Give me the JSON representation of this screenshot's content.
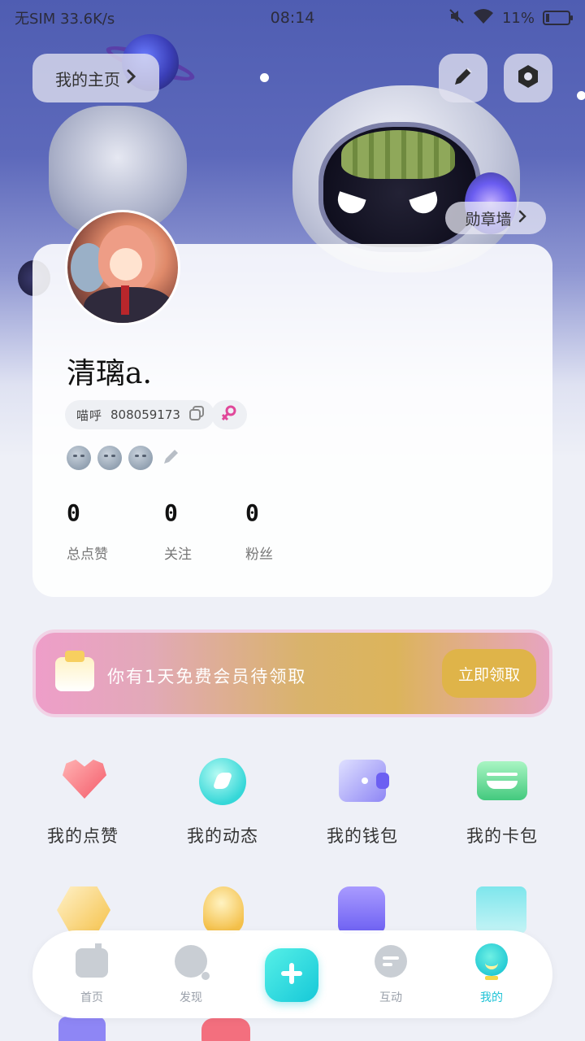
{
  "status_bar": {
    "left": "无SIM 33.6K/s",
    "time": "08:14",
    "battery": "11%"
  },
  "header": {
    "home_button_label": "我的主页",
    "badge_wall_label": "勋章墙"
  },
  "profile": {
    "nickname": "清璃a.",
    "id_label": "喵呼",
    "id_value": "808059173",
    "stats": [
      {
        "value": "0",
        "label": "总点赞"
      },
      {
        "value": "0",
        "label": "关注"
      },
      {
        "value": "0",
        "label": "粉丝"
      }
    ]
  },
  "vip_banner": {
    "text": "你有1天免费会员待领取",
    "claim_label": "立即领取"
  },
  "features": [
    {
      "label": "我的点赞",
      "icon": "heart-icon"
    },
    {
      "label": "我的动态",
      "icon": "moment-icon"
    },
    {
      "label": "我的钱包",
      "icon": "wallet-icon"
    },
    {
      "label": "我的卡包",
      "icon": "card-icon"
    }
  ],
  "bottom_nav": {
    "items": [
      {
        "label": "首页",
        "icon": "home-icon"
      },
      {
        "label": "发现",
        "icon": "discover-icon"
      },
      {
        "label": "互动",
        "icon": "interact-icon"
      },
      {
        "label": "我的",
        "icon": "me-icon"
      }
    ],
    "active": "我的"
  },
  "colors": {
    "accent": "#1ec3d6",
    "gender": "#e0489a",
    "vip_button": "#dfb449"
  }
}
